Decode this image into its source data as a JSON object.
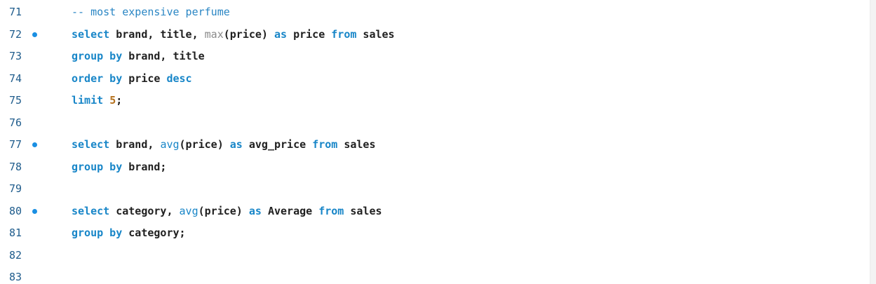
{
  "editor": {
    "lines": [
      {
        "number": "71",
        "breakpoint": false,
        "tokens": [
          {
            "t": "-- most expensive perfume",
            "c": "cmt"
          }
        ]
      },
      {
        "number": "72",
        "breakpoint": true,
        "tokens": [
          {
            "t": "select",
            "c": "kw"
          },
          {
            "t": " brand, title, ",
            "c": "id"
          },
          {
            "t": "max",
            "c": "fn-gray"
          },
          {
            "t": "(price) ",
            "c": "id"
          },
          {
            "t": "as",
            "c": "kw"
          },
          {
            "t": " price ",
            "c": "id"
          },
          {
            "t": "from",
            "c": "kw"
          },
          {
            "t": " sales",
            "c": "id"
          }
        ]
      },
      {
        "number": "73",
        "breakpoint": false,
        "tokens": [
          {
            "t": "group by",
            "c": "kw"
          },
          {
            "t": " brand, title",
            "c": "id"
          }
        ]
      },
      {
        "number": "74",
        "breakpoint": false,
        "tokens": [
          {
            "t": "order by",
            "c": "kw"
          },
          {
            "t": " price ",
            "c": "id"
          },
          {
            "t": "desc",
            "c": "kw"
          }
        ]
      },
      {
        "number": "75",
        "breakpoint": false,
        "tokens": [
          {
            "t": "limit",
            "c": "kw"
          },
          {
            "t": " ",
            "c": "id"
          },
          {
            "t": "5",
            "c": "num"
          },
          {
            "t": ";",
            "c": "pn"
          }
        ]
      },
      {
        "number": "76",
        "breakpoint": false,
        "tokens": []
      },
      {
        "number": "77",
        "breakpoint": true,
        "tokens": [
          {
            "t": "select",
            "c": "kw"
          },
          {
            "t": " brand, ",
            "c": "id"
          },
          {
            "t": "avg",
            "c": "fn-blue"
          },
          {
            "t": "(price) ",
            "c": "id"
          },
          {
            "t": "as",
            "c": "kw"
          },
          {
            "t": " avg_price ",
            "c": "id"
          },
          {
            "t": "from",
            "c": "kw"
          },
          {
            "t": " sales",
            "c": "id"
          }
        ]
      },
      {
        "number": "78",
        "breakpoint": false,
        "tokens": [
          {
            "t": "group by",
            "c": "kw"
          },
          {
            "t": " brand;",
            "c": "id"
          }
        ]
      },
      {
        "number": "79",
        "breakpoint": false,
        "tokens": []
      },
      {
        "number": "80",
        "breakpoint": true,
        "tokens": [
          {
            "t": "select",
            "c": "kw"
          },
          {
            "t": " category, ",
            "c": "id"
          },
          {
            "t": "avg",
            "c": "fn-blue"
          },
          {
            "t": "(price) ",
            "c": "id"
          },
          {
            "t": "as",
            "c": "kw"
          },
          {
            "t": " Average ",
            "c": "id"
          },
          {
            "t": "from",
            "c": "kw"
          },
          {
            "t": " sales",
            "c": "id"
          }
        ]
      },
      {
        "number": "81",
        "breakpoint": false,
        "tokens": [
          {
            "t": "group by",
            "c": "kw"
          },
          {
            "t": " category;",
            "c": "id"
          }
        ]
      },
      {
        "number": "82",
        "breakpoint": false,
        "tokens": []
      },
      {
        "number": "83",
        "breakpoint": false,
        "tokens": []
      }
    ]
  },
  "colors": {
    "keyword": "#1886c8",
    "identifier": "#202020",
    "line_number": "#1f5c8c",
    "breakpoint": "#1a8fe3",
    "number_literal": "#b5711d",
    "comment": "#2a86c4",
    "builtin_max": "#8a8a8a"
  }
}
